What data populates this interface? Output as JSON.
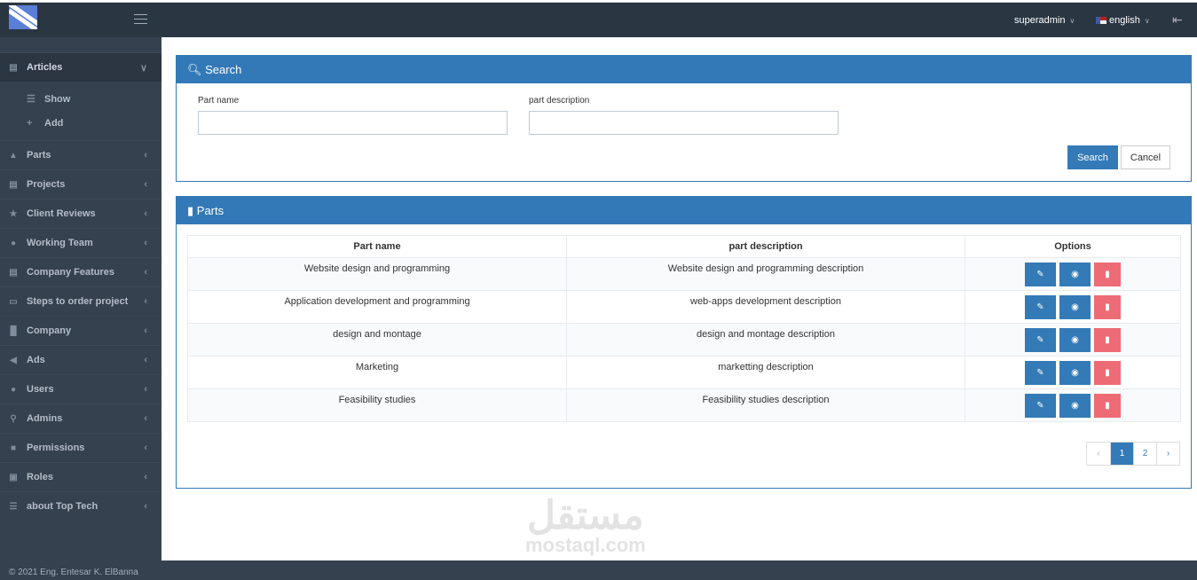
{
  "topbar": {
    "user": "superadmin",
    "language": "english"
  },
  "sidebar": {
    "items": [
      {
        "label": "Articles",
        "icon": "newspaper-icon",
        "expanded": true,
        "children": [
          {
            "label": "Show",
            "icon": "list-icon"
          },
          {
            "label": "Add",
            "icon": "plus-icon"
          }
        ]
      },
      {
        "label": "Parts",
        "icon": "thumbs-up-icon"
      },
      {
        "label": "Projects",
        "icon": "projects-icon"
      },
      {
        "label": "Client Reviews",
        "icon": "star-icon"
      },
      {
        "label": "Working Team",
        "icon": "user-icon"
      },
      {
        "label": "Company Features",
        "icon": "features-icon"
      },
      {
        "label": "Steps to order project",
        "icon": "desktop-icon"
      },
      {
        "label": "Company",
        "icon": "building-icon"
      },
      {
        "label": "Ads",
        "icon": "bullhorn-icon"
      },
      {
        "label": "Users",
        "icon": "users-icon"
      },
      {
        "label": "Admins",
        "icon": "wrench-icon"
      },
      {
        "label": "Permissions",
        "icon": "lock-icon"
      },
      {
        "label": "Roles",
        "icon": "roles-icon"
      },
      {
        "label": "about Top Tech",
        "icon": "list-icon"
      }
    ]
  },
  "search": {
    "title": "Search",
    "part_name_label": "Part name",
    "part_name_value": "",
    "part_desc_label": "part description",
    "part_desc_value": "",
    "search_btn": "Search",
    "cancel_btn": "Cancel"
  },
  "parts": {
    "title": "Parts",
    "columns": [
      "Part name",
      "part description",
      "Options"
    ],
    "rows": [
      [
        "Website design and programming",
        "Website design and programming description"
      ],
      [
        "Application development and programming",
        "web-apps development description"
      ],
      [
        "design and montage",
        "design and montage description"
      ],
      [
        "Marketing",
        "marketting description"
      ],
      [
        "Feasibility studies",
        "Feasibility studies description"
      ]
    ],
    "pagination": {
      "prev": "‹",
      "pages": [
        "1",
        "2"
      ],
      "current": "1",
      "next": "›"
    }
  },
  "footer": "© 2021 Eng. Entesar K. ElBanna",
  "watermark": {
    "arabic": "مستقل",
    "latin": "mostaql.com"
  },
  "colors": {
    "primary": "#3379b7",
    "danger": "#ed6b75",
    "sidebar": "#364150"
  }
}
